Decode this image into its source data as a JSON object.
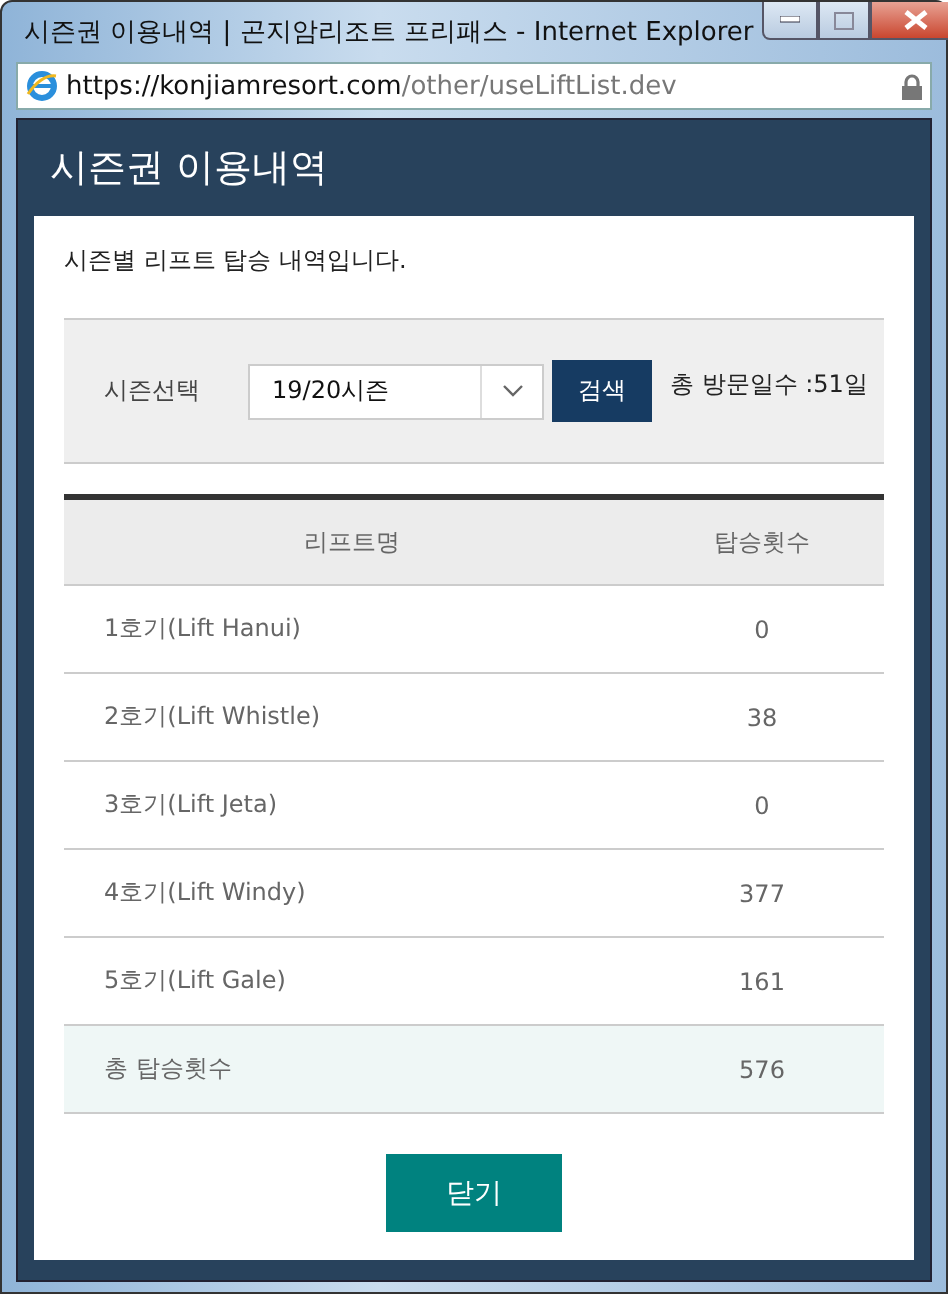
{
  "window": {
    "title": "시즌권 이용내역 | 곤지암리조트 프리패스 - Internet Explorer",
    "address": {
      "host": "https://konjiamresort.com",
      "path": "/other/useLiftList.dev"
    }
  },
  "dialog": {
    "title": "시즌권 이용내역",
    "description": "시즌별 리프트 탑승 내역입니다.",
    "filter": {
      "label": "시즌선택",
      "value": "19/20시즌",
      "search_button": "검색",
      "visit_total": "총 방문일수 :51일"
    },
    "table": {
      "columns": [
        "리프트명",
        "탑승횟수"
      ],
      "rows": [
        {
          "kind": "item",
          "cells": [
            "1호기(Lift Hanui)",
            "0"
          ]
        },
        {
          "kind": "item",
          "cells": [
            "2호기(Lift Whistle)",
            "38"
          ]
        },
        {
          "kind": "item",
          "cells": [
            "3호기(Lift Jeta)",
            "0"
          ]
        },
        {
          "kind": "item",
          "cells": [
            "4호기(Lift Windy)",
            "377"
          ]
        },
        {
          "kind": "item",
          "cells": [
            "5호기(Lift Gale)",
            "161"
          ]
        },
        {
          "kind": "total",
          "cells": [
            "총 탑승횟수",
            "576"
          ]
        }
      ]
    },
    "close_button": "닫기"
  }
}
